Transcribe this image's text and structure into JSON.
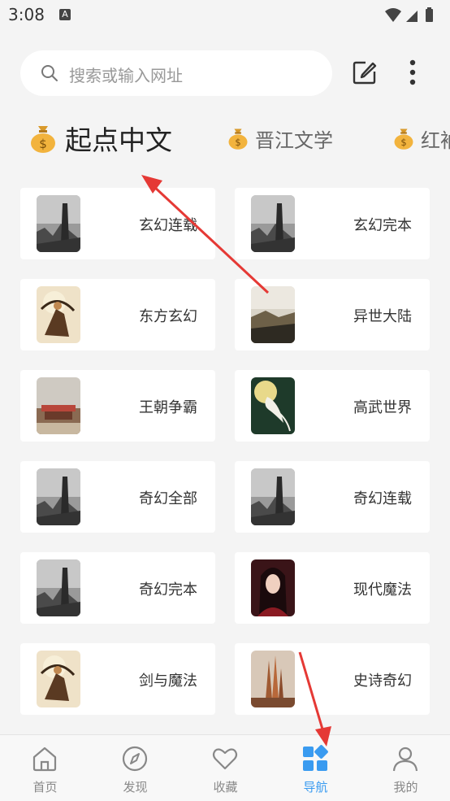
{
  "status": {
    "time": "3:08",
    "notify_letter": "A"
  },
  "search": {
    "placeholder": "搜索或输入网址"
  },
  "tabs": [
    {
      "label": "起点中文",
      "active": true
    },
    {
      "label": "晋江文学",
      "active": false
    },
    {
      "label": "红袖",
      "active": false
    }
  ],
  "cards": [
    {
      "label": "玄幻连载",
      "image": "dark-tower"
    },
    {
      "label": "玄幻完本",
      "image": "dark-tower"
    },
    {
      "label": "东方玄幻",
      "image": "archer"
    },
    {
      "label": "异世大陆",
      "image": "landscape"
    },
    {
      "label": "王朝争霸",
      "image": "palace"
    },
    {
      "label": "高武世界",
      "image": "moon-bird"
    },
    {
      "label": "奇幻全部",
      "image": "dark-tower"
    },
    {
      "label": "奇幻连载",
      "image": "dark-tower"
    },
    {
      "label": "奇幻完本",
      "image": "dark-tower"
    },
    {
      "label": "现代魔法",
      "image": "portrait"
    },
    {
      "label": "剑与魔法",
      "image": "archer"
    },
    {
      "label": "史诗奇幻",
      "image": "spires"
    }
  ],
  "nav": [
    {
      "label": "首页",
      "icon": "home-icon",
      "active": false
    },
    {
      "label": "发现",
      "icon": "compass-icon",
      "active": false
    },
    {
      "label": "收藏",
      "icon": "heart-icon",
      "active": false
    },
    {
      "label": "导航",
      "icon": "grid-icon",
      "active": true
    },
    {
      "label": "我的",
      "icon": "user-icon",
      "active": false
    }
  ],
  "colors": {
    "accent": "#3a9bf0",
    "arrow": "#e53935",
    "background": "#f4f4f4"
  }
}
